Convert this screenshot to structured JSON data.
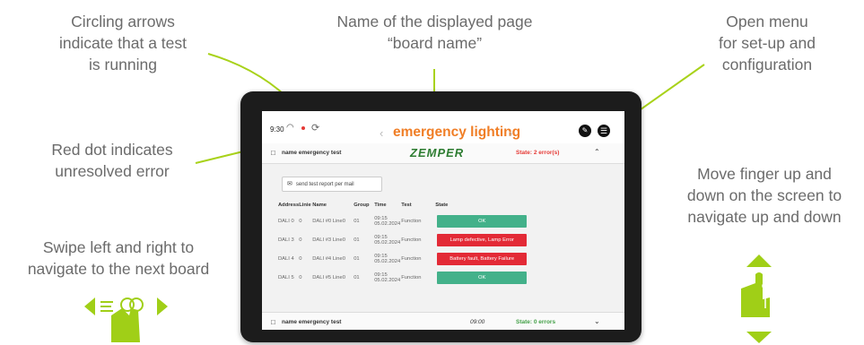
{
  "annotations": {
    "circling_arrows": [
      "Circling arrows",
      "indicate that a test",
      "is running"
    ],
    "board_name": [
      "Name of the displayed page",
      "“board name”"
    ],
    "open_menu": [
      "Open menu",
      "for set-up and",
      "configuration"
    ],
    "red_dot": [
      "Red dot indicates",
      "unresolved error"
    ],
    "swipe": [
      "Swipe left and right to",
      "navigate to the next board"
    ],
    "move_finger": [
      "Move finger up and",
      "down on the screen to",
      "navigate up and down"
    ]
  },
  "status_bar": {
    "time": "9:30"
  },
  "header": {
    "title": "emergency lighting",
    "prev": "‹",
    "next": "›"
  },
  "section1": {
    "name": "name emergency test",
    "logo": "ZEMPER",
    "state": "State: 2 error(s)"
  },
  "mail_button": {
    "label": "send test report per mail"
  },
  "table": {
    "headers": [
      "Address",
      "Linie",
      "Name",
      "Group",
      "Time",
      "Test",
      "State"
    ],
    "rows": [
      {
        "address": "DALI 0",
        "linie": "0",
        "name": "DALI #0 Line0",
        "group": "01",
        "time1": "09:15",
        "time2": "05.02.2024",
        "test": "Function",
        "state": "OK",
        "state_type": "ok"
      },
      {
        "address": "DALI 3",
        "linie": "0",
        "name": "DALI #3 Line0",
        "group": "01",
        "time1": "09:15",
        "time2": "05.02.2024",
        "test": "Function",
        "state": "Lamp defective, Lamp Error",
        "state_type": "err"
      },
      {
        "address": "DALI 4",
        "linie": "0",
        "name": "DALI #4 Line0",
        "group": "01",
        "time1": "09:15",
        "time2": "05.02.2024",
        "test": "Function",
        "state": "Battery fault, Battery Failure",
        "state_type": "err"
      },
      {
        "address": "DALI 5",
        "linie": "0",
        "name": "DALI #5 Line0",
        "group": "01",
        "time1": "09:15",
        "time2": "05.02.2024",
        "test": "Function",
        "state": "OK",
        "state_type": "ok"
      }
    ]
  },
  "section2": {
    "name": "name emergency test",
    "time": "09:00",
    "state": "State: 0 errors"
  },
  "icons": {
    "wifi": "wifi-icon",
    "spin": "circling-arrows-icon",
    "pen": "pen-icon",
    "menu": "menu-icon",
    "mail": "mail-icon",
    "board": "board-icon",
    "chevron_up": "chevron-up-icon",
    "chevron_down": "chevron-down-icon",
    "swipe": "swipe-gesture-icon",
    "scroll": "scroll-gesture-icon"
  },
  "colors": {
    "accent_orange": "#f07e26",
    "gesture_green": "#a0cf17",
    "pointer_line": "#a8d21a",
    "ok_green": "#43b18a",
    "error_red": "#e32a36"
  }
}
